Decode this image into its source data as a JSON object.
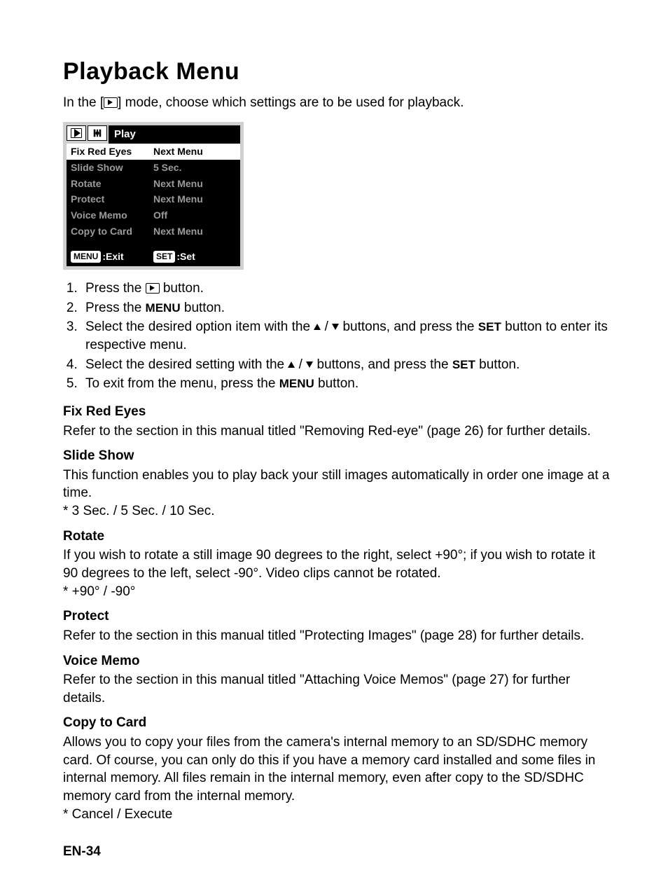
{
  "title": "Playback Menu",
  "intro_before": "In the [",
  "intro_after": "] mode, choose which settings are to be used for playback.",
  "screenshot": {
    "tab_title": "Play",
    "rows": [
      {
        "label": "Fix Red Eyes",
        "value": "Next Menu",
        "selected": true
      },
      {
        "label": "Slide Show",
        "value": "5 Sec.",
        "selected": false
      },
      {
        "label": "Rotate",
        "value": "Next Menu",
        "selected": false
      },
      {
        "label": "Protect",
        "value": "Next Menu",
        "selected": false
      },
      {
        "label": "Voice Memo",
        "value": "Off",
        "selected": false
      },
      {
        "label": "Copy to Card",
        "value": "Next Menu",
        "selected": false
      }
    ],
    "footer_menu_chip": "MENU",
    "footer_menu_label": ":Exit",
    "footer_set_chip": "SET",
    "footer_set_label": ":Set"
  },
  "steps": {
    "s1a": "Press the ",
    "s1b": " button.",
    "s2a": "Press the ",
    "s2b": "MENU",
    "s2c": " button.",
    "s3a": "Select the desired option item with the ",
    "s3b": " / ",
    "s3c": " buttons, and press the ",
    "s3d": "SET",
    "s3e": " button to enter its respective menu.",
    "s4a": "Select the desired setting with the ",
    "s4b": " / ",
    "s4c": " buttons, and press the ",
    "s4d": "SET",
    "s4e": " button.",
    "s5a": "To exit from the menu, press the ",
    "s5b": "MENU",
    "s5c": " button."
  },
  "sections": {
    "fix_red_eyes_h": "Fix Red Eyes",
    "fix_red_eyes_b": "Refer to the section in this manual titled \"Removing Red-eye\" (page 26) for further details.",
    "slide_show_h": "Slide Show",
    "slide_show_b1": "This function enables you to play back your still images automatically in order one image at a time.",
    "slide_show_b2": "*  3 Sec. / 5 Sec. / 10 Sec.",
    "rotate_h": "Rotate",
    "rotate_b1": "If you wish to rotate a still image 90 degrees to the right, select +90°; if you wish to rotate it 90 degrees to the left, select -90°. Video clips cannot be rotated.",
    "rotate_b2": "* +90° / -90°",
    "protect_h": "Protect",
    "protect_b": "Refer to the section in this manual titled \"Protecting Images\" (page 28) for further details.",
    "voice_memo_h": "Voice Memo",
    "voice_memo_b": "Refer to the section in this manual titled \"Attaching Voice Memos\" (page 27) for further details.",
    "copy_to_card_h": "Copy to Card",
    "copy_to_card_b1": "Allows you to copy your files from the camera's internal memory to an SD/SDHC memory card. Of course, you can only do this if you have a memory card installed and some files in internal memory. All files remain in the internal memory, even after copy to the SD/SDHC memory card from the internal memory.",
    "copy_to_card_b2": "* Cancel / Execute"
  },
  "page_number": "EN-34"
}
